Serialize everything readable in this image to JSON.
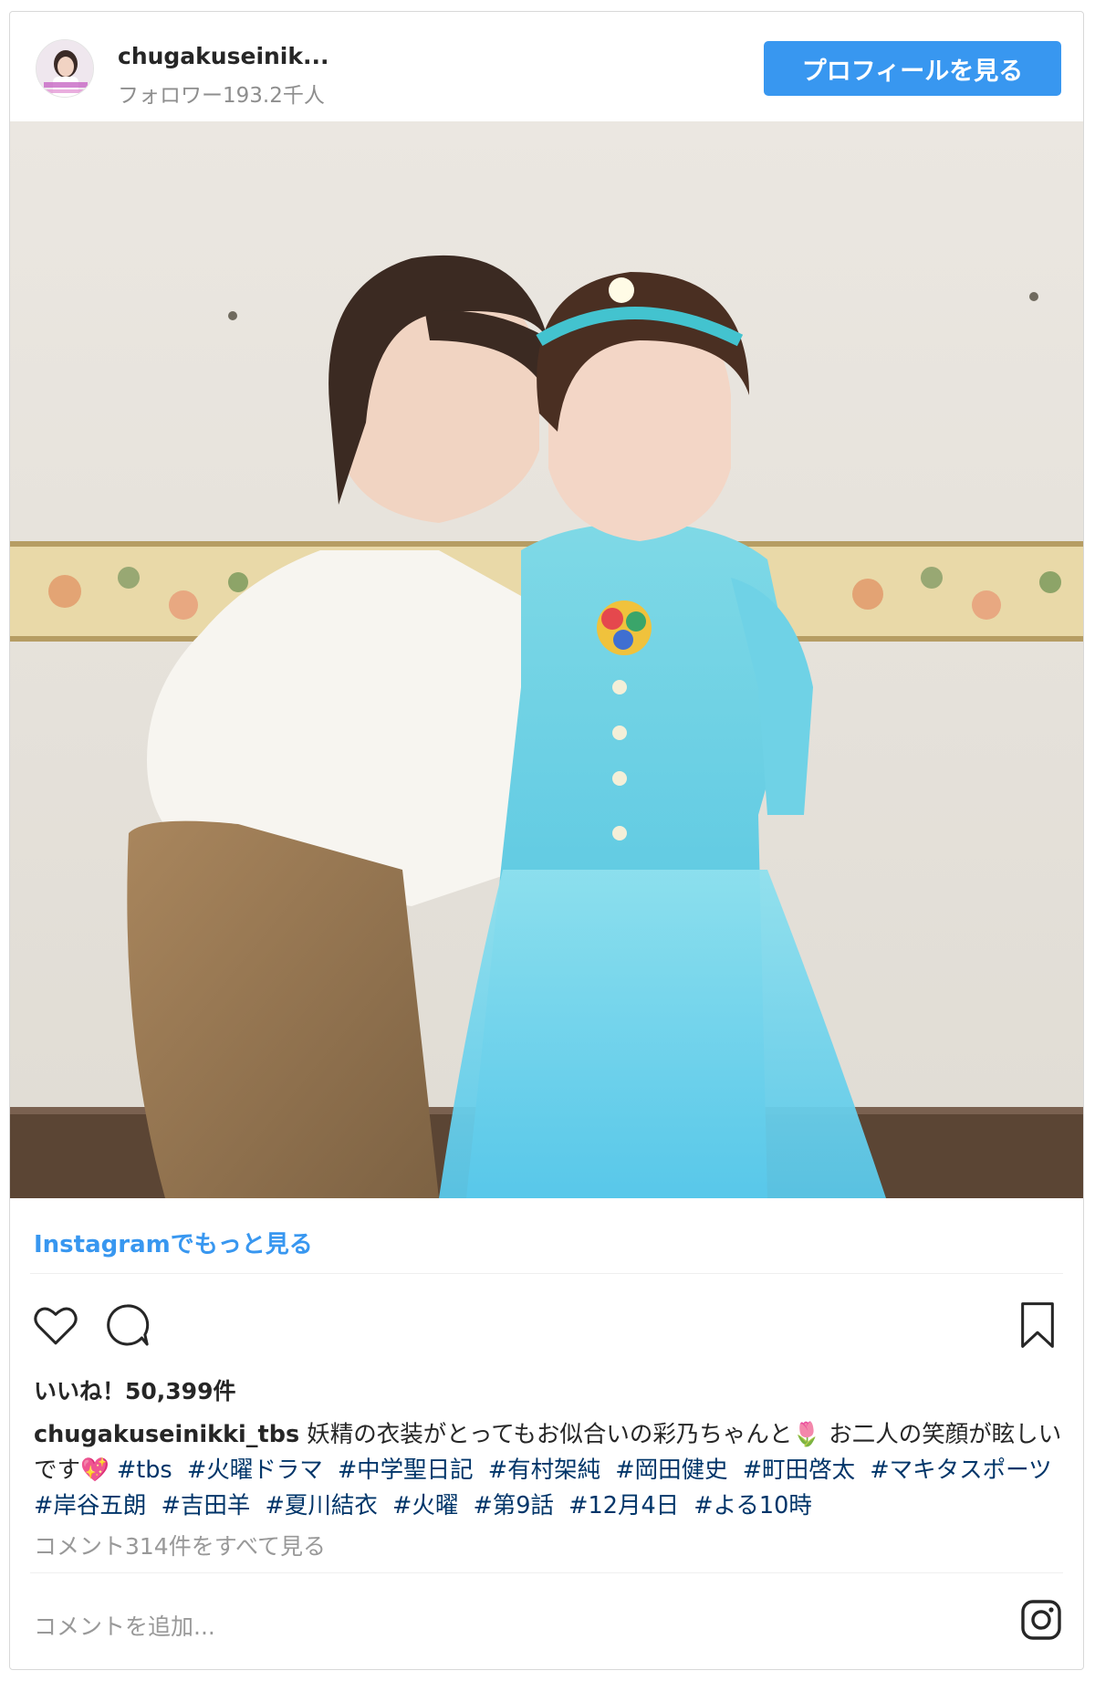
{
  "header": {
    "username": "chugakuseinik...",
    "followers": "フォロワー193.2千人",
    "profile_button": "プロフィールを見る"
  },
  "post": {
    "more_link": "Instagramでもっと見る",
    "likes": "いいね！50,399件",
    "caption_user": "chugakuseinikki_tbs",
    "caption_text": "妖精の衣装がとってもお似合いの彩乃ちゃんと🌷 お二人の笑顔が眩しいです💖",
    "hashtags": [
      "#tbs",
      "#火曜ドラマ",
      "#中学聖日記",
      "#有村架純",
      "#岡田健史",
      "#町田啓太",
      "#マキタスポーツ",
      "#岸谷五朗",
      "#吉田羊",
      "#夏川結衣",
      "#火曜",
      "#第9話",
      "#12月4日",
      "#よる10時"
    ],
    "view_comments": "コメント314件をすべて見る",
    "add_comment_placeholder": "コメントを追加..."
  },
  "icons": [
    "heart-icon",
    "comment-icon",
    "bookmark-icon",
    "instagram-icon"
  ],
  "colors": {
    "accent": "#3897f0",
    "text": "#262626",
    "muted": "#999999",
    "hashtag": "#003569"
  }
}
